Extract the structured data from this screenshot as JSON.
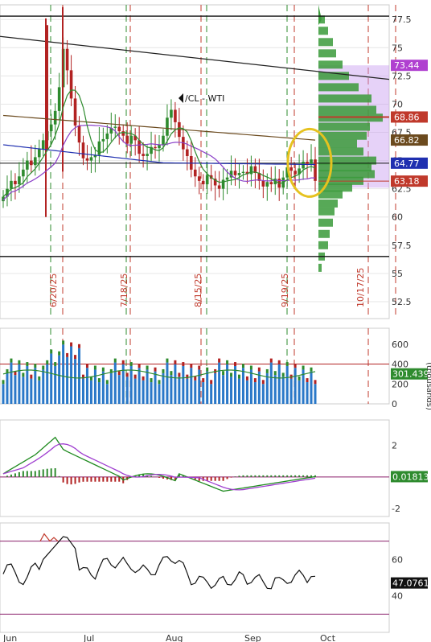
{
  "chart_data": [
    {
      "type": "candlestick",
      "panel": "price",
      "annotation": "/CL - WTI",
      "y_ticks": [
        "77.5",
        "75",
        "72.5",
        "70",
        "67.5",
        "65",
        "62.5",
        "60",
        "57.5",
        "55",
        "52.5"
      ],
      "y_tick_values": [
        77.5,
        75,
        72.5,
        70,
        67.5,
        65,
        62.5,
        60,
        57.5,
        55,
        52.5
      ],
      "ylim": [
        51.0,
        78.8
      ],
      "x_axis_labels": [
        "Jun",
        "Jul",
        "Aug",
        "Sep",
        "Oct"
      ],
      "vertical_date_labels": [
        "6/20/25",
        "7/18/25",
        "8/15/25",
        "9/19/25",
        "10/17/25"
      ],
      "horizontal_levels": [
        77.8,
        56.5
      ],
      "badges": [
        {
          "text": "73.44",
          "value": 73.44,
          "color": "#b040d0"
        },
        {
          "text": "68.86",
          "value": 68.86,
          "color": "#c0392b"
        },
        {
          "text": "66.82",
          "value": 66.82,
          "color": "#6b4a1e"
        },
        {
          "text": "64.77",
          "value": 64.77,
          "color": "#1f2fb0"
        },
        {
          "text": "63.18",
          "value": 63.18,
          "color": "#c0392b"
        }
      ],
      "closes": [
        61.8,
        62.5,
        63.2,
        62.9,
        63.6,
        64.2,
        65.0,
        64.6,
        65.3,
        66.0,
        66.8,
        67.6,
        68.2,
        69.4,
        71.5,
        74.9,
        73.0,
        70.5,
        68.1,
        66.6,
        65.2,
        65.0,
        65.3,
        65.5,
        66.7,
        66.9,
        67.4,
        67.9,
        68.0,
        67.6,
        67.2,
        66.5,
        67.2,
        66.8,
        65.6,
        65.4,
        65.6,
        66.2,
        66.1,
        66.4,
        67.2,
        68.8,
        69.5,
        68.4,
        67.1,
        66.0,
        65.4,
        64.2,
        63.6,
        63.2,
        62.9,
        63.7,
        63.4,
        62.8,
        62.5,
        63.3,
        63.5,
        64.1,
        63.7,
        63.9,
        64.0,
        63.8,
        64.5,
        63.9,
        63.2,
        62.7,
        63.1,
        62.9,
        63.4,
        62.6,
        63.5,
        64.4,
        64.1,
        63.8,
        64.3,
        64.9,
        64.7,
        65.1,
        63.2
      ]
    },
    {
      "type": "bar",
      "panel": "volume",
      "y_ticks": [
        "600",
        "400",
        "200",
        "0"
      ],
      "y_tick_values": [
        600,
        400,
        200,
        0
      ],
      "ylim": [
        0,
        760
      ],
      "reference_level": 400,
      "side_label": "(thousands)",
      "last_value": 301.439,
      "last_value_label": "301.439"
    },
    {
      "type": "line",
      "panel": "macd",
      "y_ticks": [
        "2",
        "-2"
      ],
      "y_tick_values": [
        2,
        -2
      ],
      "ylim": [
        -2.5,
        3.6
      ],
      "zero_line": 0,
      "last_value": 0.01813,
      "last_value_label": "0.01813"
    },
    {
      "type": "line",
      "panel": "rsi",
      "y_ticks": [
        "60",
        "40"
      ],
      "y_tick_values": [
        60,
        40
      ],
      "ylim": [
        20,
        80
      ],
      "overbought": 70,
      "oversold": 30,
      "last_value": 47.0761,
      "last_value_label": "47.0761"
    }
  ],
  "colors": {
    "up_candle": "#2e8b2e",
    "down_candle": "#b22222",
    "volume_bar": "#2a78c8",
    "volume_profile": "#3a9a3a",
    "value_area": "#c89cf0",
    "highlight_circle": "#e6c21f",
    "grid_vertical_green": "#2e8b2e",
    "grid_vertical_red": "#c0392b"
  }
}
